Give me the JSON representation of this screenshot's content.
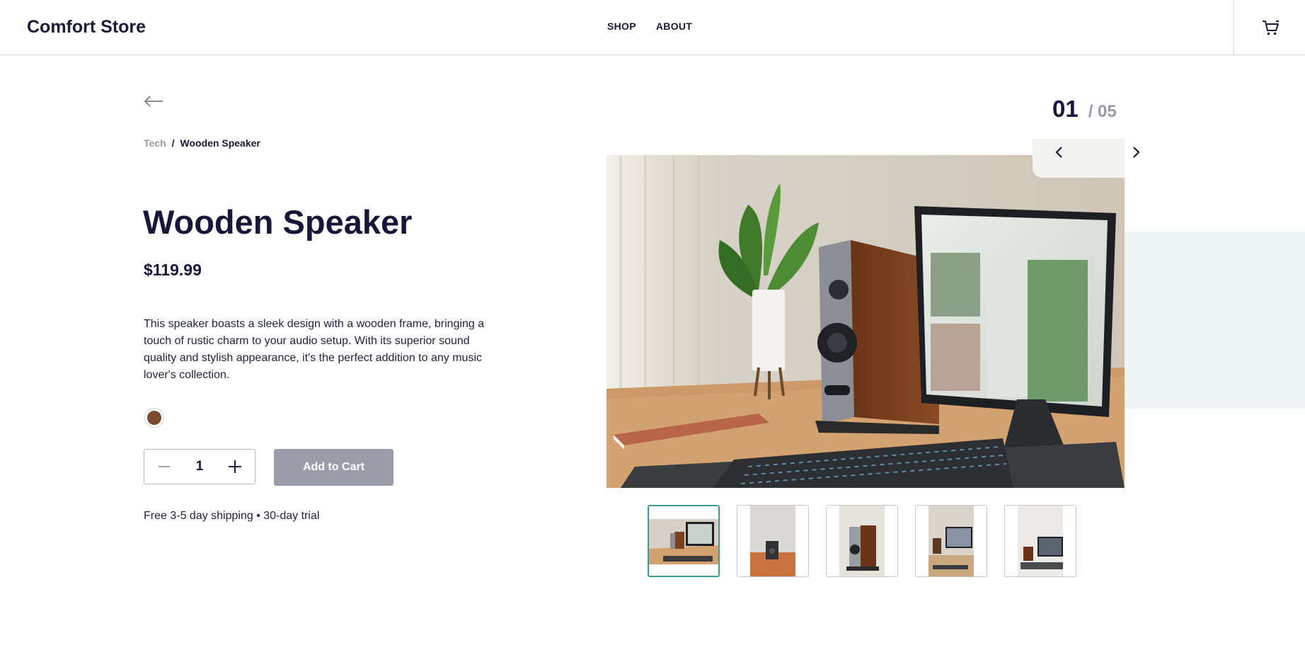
{
  "header": {
    "logo": "Comfort Store",
    "nav": [
      {
        "label": "SHOP"
      },
      {
        "label": "ABOUT"
      }
    ],
    "cart_icon": "cart-icon"
  },
  "breadcrumb": {
    "category": "Tech",
    "separator": "/",
    "current": "Wooden Speaker"
  },
  "product": {
    "title": "Wooden Speaker",
    "price": "$119.99",
    "description": "This speaker boasts a sleek design with a wooden frame, bringing a touch of rustic charm to your audio setup. With its superior sound quality and stylish appearance, it's the perfect addition to any music lover's collection.",
    "color_swatch": "#7a4a2a",
    "quantity": "1",
    "add_to_cart": "Add to Cart",
    "add_to_cart_color": "#9b9daa",
    "shipping": "Free 3-5 day shipping • 30-day trial"
  },
  "gallery": {
    "current": "01",
    "total": "/ 05",
    "accent": "#3a9e96",
    "thumbnails": [
      {
        "name": "thumb-desk-setup",
        "active": true
      },
      {
        "name": "thumb-speaker-front",
        "active": false
      },
      {
        "name": "thumb-speaker-angle",
        "active": false
      },
      {
        "name": "thumb-speaker-monitor",
        "active": false
      },
      {
        "name": "thumb-speaker-desk",
        "active": false
      }
    ]
  }
}
